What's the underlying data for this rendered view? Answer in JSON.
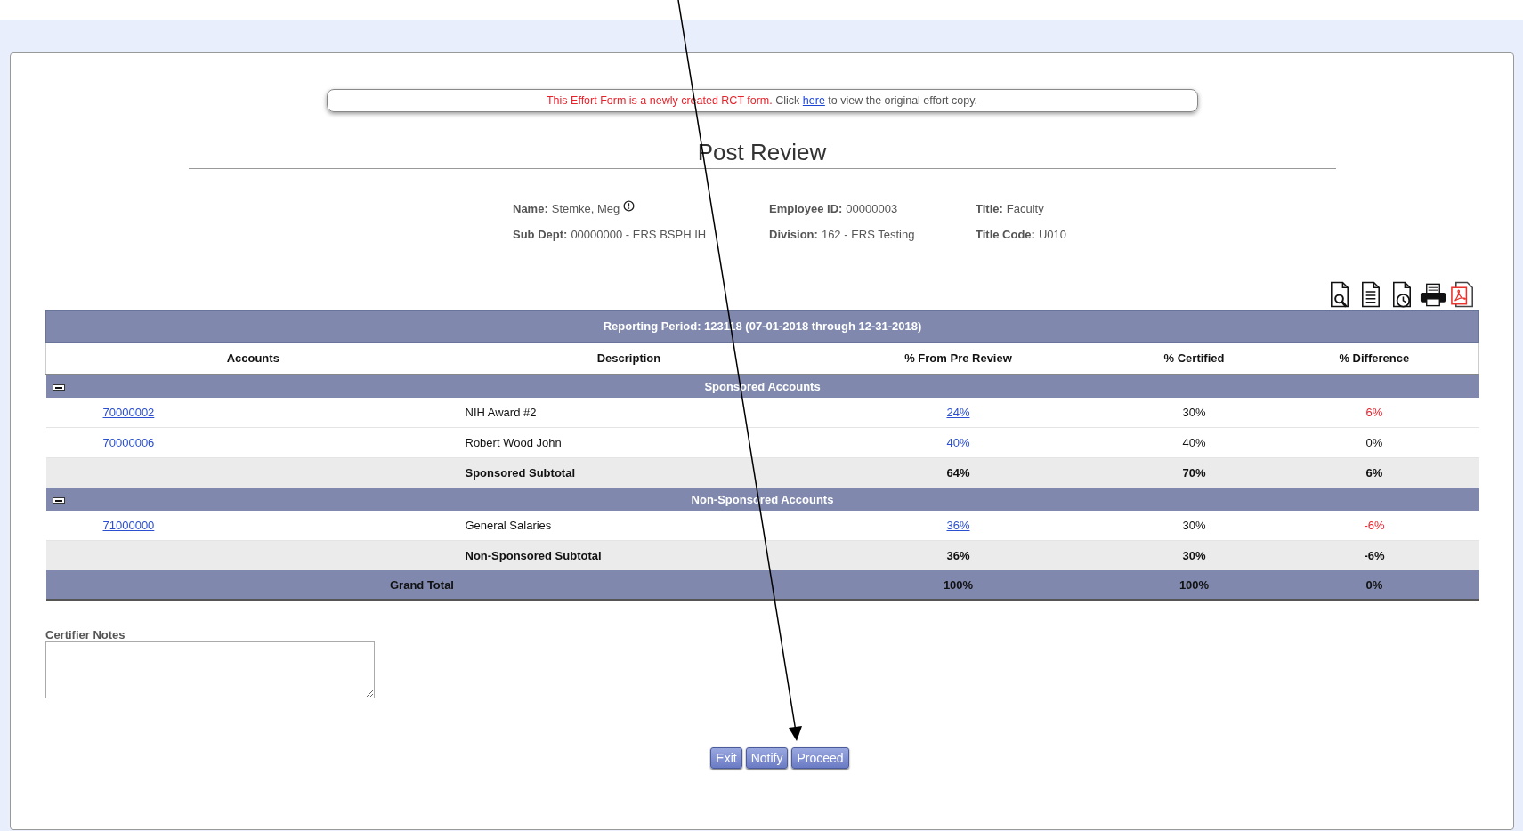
{
  "notice": {
    "text": "This Effort Form is a newly created RCT form.",
    "prompt": "Click",
    "link": "here",
    "suffix": "to view the original effort copy."
  },
  "page_title": "Post Review",
  "employee": [
    {
      "label": "Name:",
      "value": "Stemke, Meg",
      "info": true
    },
    {
      "label": "Sub Dept:",
      "value": "00000000 - ERS BSPH IH",
      "info": false
    },
    {
      "label": "Employee ID:",
      "value": "00000003",
      "info": false
    },
    {
      "label": "Division:",
      "value": "162 - ERS Testing",
      "info": false
    },
    {
      "label": "Title:",
      "value": "Faculty",
      "info": false
    },
    {
      "label": "Title Code:",
      "value": "U010",
      "info": false
    }
  ],
  "toolbar": [
    {
      "kind": "preview"
    },
    {
      "kind": "document"
    },
    {
      "kind": "history"
    },
    {
      "kind": "print"
    },
    {
      "kind": "pdf"
    }
  ],
  "table": {
    "title": "Reporting Period: 123118 (07-01-2018 through 12-31-2018)",
    "columns": [
      "Accounts",
      "Description",
      "% From Pre Review",
      "% Certified",
      "% Difference"
    ],
    "sections": [
      {
        "title": "Sponsored Accounts",
        "expanded": true,
        "rows": [
          {
            "account": "70000002",
            "description": "NIH Award #2",
            "from_pre_review": "24%",
            "certified": "30%",
            "difference": "6%",
            "flagged": true
          },
          {
            "account": "70000006",
            "description": "Robert Wood John",
            "from_pre_review": "40%",
            "certified": "40%",
            "difference": "0%",
            "flagged": false
          }
        ],
        "subtotal": {
          "label": "Sponsored Subtotal",
          "from_pre_review": "64%",
          "certified": "70%",
          "difference": "6%"
        }
      },
      {
        "title": "Non-Sponsored Accounts",
        "expanded": true,
        "rows": [
          {
            "account": "71000000",
            "description": "General Salaries",
            "from_pre_review": "36%",
            "certified": "30%",
            "difference": "-6%",
            "flagged": true
          }
        ],
        "subtotal": {
          "label": "Non-Sponsored Subtotal",
          "from_pre_review": "36%",
          "certified": "30%",
          "difference": "-6%"
        }
      }
    ],
    "grand_total": {
      "label": "Grand Total",
      "from_pre_review": "100%",
      "certified": "100%",
      "difference": "0%"
    }
  },
  "notes": {
    "label": "Certifier Notes"
  },
  "buttons": [
    "Exit",
    "Notify",
    "Proceed"
  ]
}
